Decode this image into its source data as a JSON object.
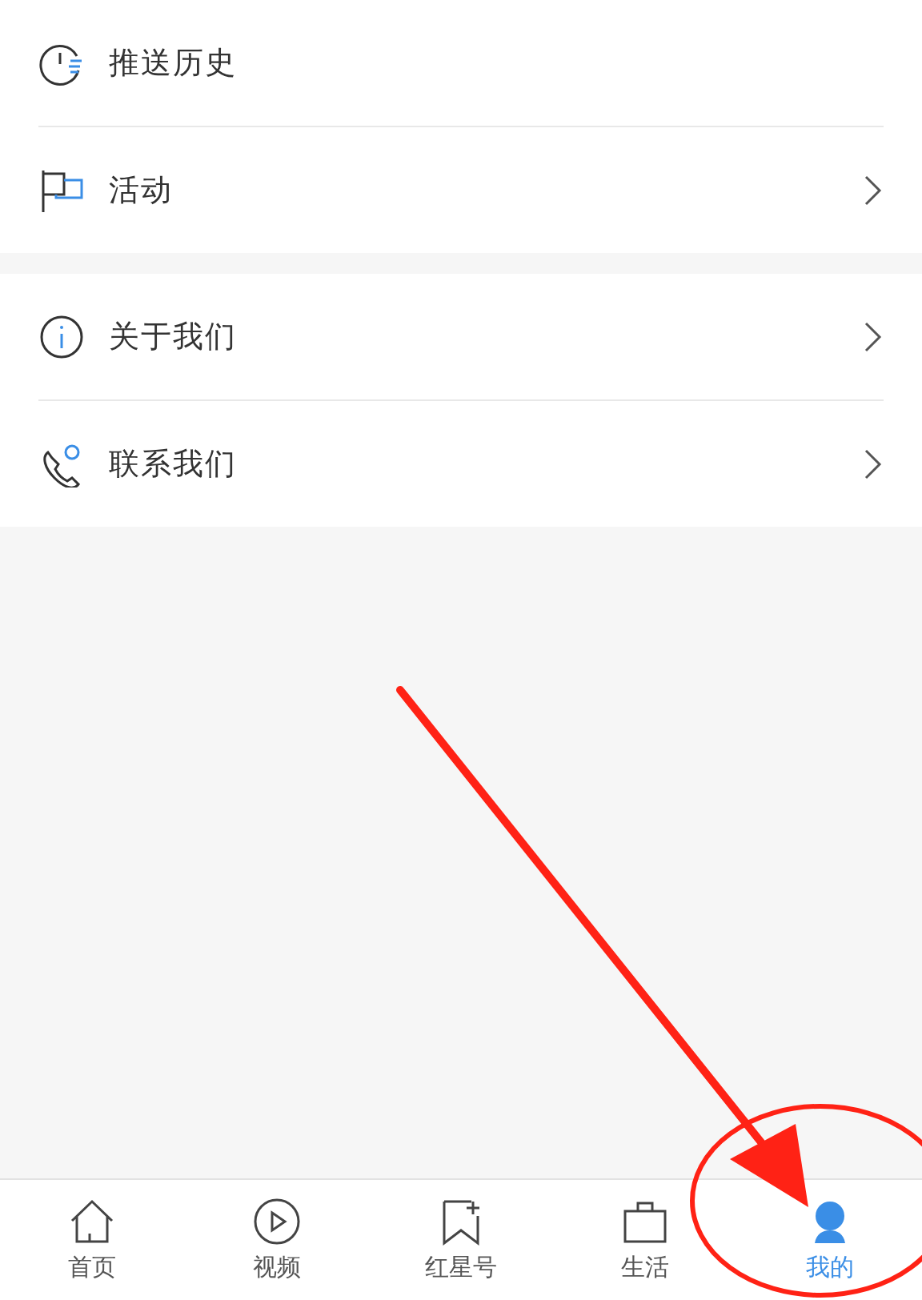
{
  "groups": [
    {
      "items": [
        {
          "label": "推送历史",
          "chevron": false
        },
        {
          "label": "活动",
          "chevron": true
        }
      ]
    },
    {
      "items": [
        {
          "label": "关于我们",
          "chevron": true
        },
        {
          "label": "联系我们",
          "chevron": true
        }
      ]
    }
  ],
  "tab_bar": [
    {
      "label": "首页",
      "selected": false
    },
    {
      "label": "视频",
      "selected": false
    },
    {
      "label": "红星号",
      "selected": false
    },
    {
      "label": "生活",
      "selected": false
    },
    {
      "label": "我的",
      "selected": true
    }
  ],
  "annotations": [
    {
      "color": "#ff2215"
    },
    {
      "color": "#ff2215"
    }
  ]
}
